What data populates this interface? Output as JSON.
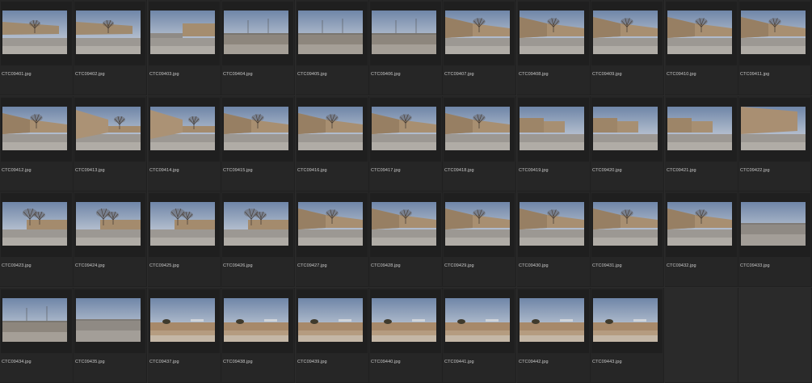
{
  "grid": {
    "cells": [
      {
        "name": "CTC09401.jpg",
        "scene": "tree-far"
      },
      {
        "name": "CTC09402.jpg",
        "scene": "tree-far"
      },
      {
        "name": "CTC09403.jpg",
        "scene": "open-building"
      },
      {
        "name": "CTC09404.jpg",
        "scene": "open-poles"
      },
      {
        "name": "CTC09405.jpg",
        "scene": "open-poles"
      },
      {
        "name": "CTC09406.jpg",
        "scene": "open-poles"
      },
      {
        "name": "CTC09407.jpg",
        "scene": "tree-building"
      },
      {
        "name": "CTC09408.jpg",
        "scene": "tree-building"
      },
      {
        "name": "CTC09409.jpg",
        "scene": "tree-building"
      },
      {
        "name": "CTC09410.jpg",
        "scene": "tree-building"
      },
      {
        "name": "CTC09411.jpg",
        "scene": "tree-building"
      },
      {
        "name": "CTC09412.jpg",
        "scene": "tree-building"
      },
      {
        "name": "CTC09413.jpg",
        "scene": "wall-left"
      },
      {
        "name": "CTC09414.jpg",
        "scene": "wall-left"
      },
      {
        "name": "CTC09415.jpg",
        "scene": "tree-building"
      },
      {
        "name": "CTC09416.jpg",
        "scene": "tree-building"
      },
      {
        "name": "CTC09417.jpg",
        "scene": "tree-building"
      },
      {
        "name": "CTC09418.jpg",
        "scene": "tree-building"
      },
      {
        "name": "CTC09419.jpg",
        "scene": "long-building"
      },
      {
        "name": "CTC09420.jpg",
        "scene": "long-building"
      },
      {
        "name": "CTC09421.jpg",
        "scene": "long-building"
      },
      {
        "name": "CTC09422.jpg",
        "scene": "wall-close"
      },
      {
        "name": "CTC09423.jpg",
        "scene": "tree-center"
      },
      {
        "name": "CTC09424.jpg",
        "scene": "tree-center"
      },
      {
        "name": "CTC09425.jpg",
        "scene": "tree-center"
      },
      {
        "name": "CTC09426.jpg",
        "scene": "tree-center"
      },
      {
        "name": "CTC09427.jpg",
        "scene": "tree-building"
      },
      {
        "name": "CTC09428.jpg",
        "scene": "tree-building"
      },
      {
        "name": "CTC09429.jpg",
        "scene": "tree-building"
      },
      {
        "name": "CTC09430.jpg",
        "scene": "tree-building"
      },
      {
        "name": "CTC09431.jpg",
        "scene": "tree-building"
      },
      {
        "name": "CTC09432.jpg",
        "scene": "tree-building"
      },
      {
        "name": "CTC09433.jpg",
        "scene": "open-ground"
      },
      {
        "name": "CTC09434.jpg",
        "scene": "open-poles"
      },
      {
        "name": "CTC09435.jpg",
        "scene": "open-ground"
      },
      {
        "name": "CTC09437.jpg",
        "scene": "field-bush"
      },
      {
        "name": "CTC09438.jpg",
        "scene": "field-bush"
      },
      {
        "name": "CTC09439.jpg",
        "scene": "field-bush"
      },
      {
        "name": "CTC09440.jpg",
        "scene": "field-bush"
      },
      {
        "name": "CTC09441.jpg",
        "scene": "field-bush"
      },
      {
        "name": "CTC09442.jpg",
        "scene": "field-bush"
      },
      {
        "name": "CTC09443.jpg",
        "scene": "field-bush"
      },
      {
        "name": "",
        "scene": "empty"
      },
      {
        "name": "",
        "scene": "empty"
      }
    ]
  }
}
